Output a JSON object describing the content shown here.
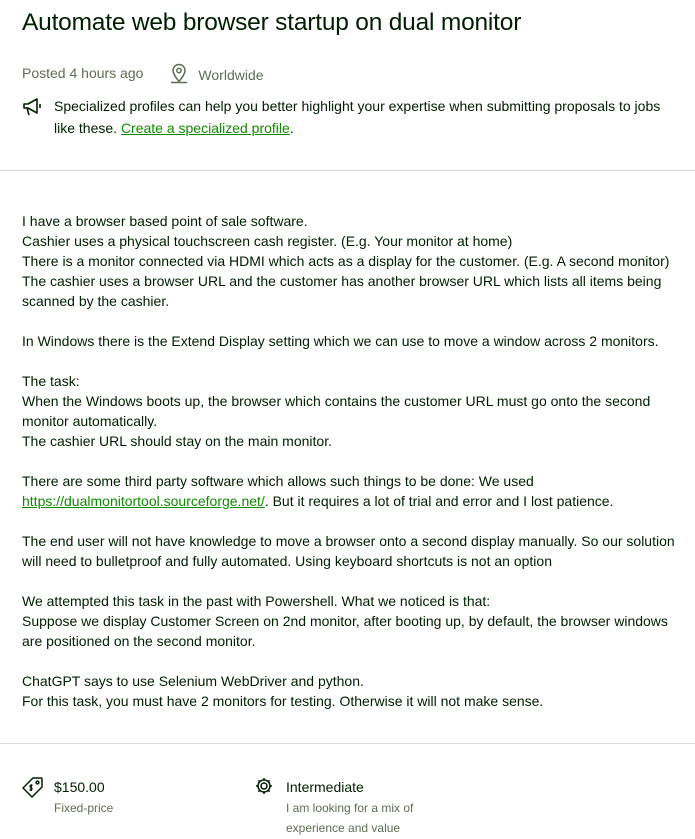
{
  "job": {
    "title": "Automate web browser startup on dual monitor",
    "posted": "Posted 4 hours ago",
    "location": "Worldwide"
  },
  "notice": {
    "text": "Specialized profiles can help you better highlight your expertise when submitting proposals to jobs like these. ",
    "link": "Create a specialized profile",
    "end": "."
  },
  "description": {
    "p1_l1": "I have a browser based point of sale software.",
    "p1_l2": "Cashier uses a physical touchscreen cash register. (E.g. Your monitor at home)",
    "p1_l3": "There is a monitor connected via HDMI which acts as a display for the customer. (E.g. A second monitor)",
    "p1_l4": "The cashier uses a browser URL and the customer has another browser URL which lists all items being scanned by the cashier.",
    "p2": "In Windows there is the Extend Display setting which we can use to move a window across 2 monitors.",
    "p3_l1": "The task:",
    "p3_l2": "When the Windows boots up, the browser which contains the customer URL must go onto the second monitor automatically.",
    "p3_l3": "The cashier URL should stay on the main monitor.",
    "p4_l1": "There are some third party software which allows such things to be done: We used",
    "p4_link": "https://dualmonitortool.sourceforge.net/",
    "p4_rest": ".  But it requires a lot of trial and error and I lost patience.",
    "p5": "The end user will not have knowledge to move a browser onto a second display manually. So our solution will need to bulletproof and fully automated. Using keyboard shortcuts is not an option",
    "p6_l1": "We attempted this task in the past with Powershell. What we noticed is that:",
    "p6_l2": "Suppose we display Customer Screen on 2nd monitor, after booting up, by default, the browser windows are positioned on the second monitor.",
    "p7_l1": "ChatGPT says to use Selenium WebDriver and python.",
    "p7_l2": "For this task, you must have 2 monitors for testing. Otherwise it will not make sense."
  },
  "features": {
    "price": "$150.00",
    "price_type": "Fixed-price",
    "level": "Intermediate",
    "level_desc": "I am looking for a mix of experience and value"
  },
  "icons": {
    "location": "location-pin-icon",
    "megaphone": "megaphone-icon",
    "price_tag": "price-tag-icon",
    "level": "expertise-gear-icon"
  },
  "colors": {
    "text": "#001e00",
    "muted": "#5e6d55",
    "link": "#108a00",
    "divider": "#d5e0d5"
  }
}
